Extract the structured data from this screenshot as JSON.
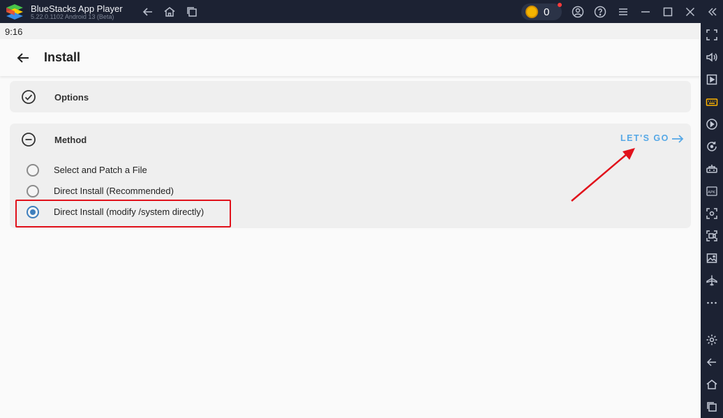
{
  "window": {
    "title": "BlueStacks App Player",
    "version": "5.22.0.1102  Android 13 (Beta)",
    "coins": "0",
    "titlebar_icons": [
      "back-icon",
      "home-icon",
      "multi-instance-icon",
      "account-icon",
      "help-icon",
      "menu-icon",
      "minimize-icon",
      "maximize-icon",
      "close-icon"
    ]
  },
  "android": {
    "clock": "9:16",
    "page_title": "Install",
    "options_card": {
      "title": "Options"
    },
    "method_card": {
      "title": "Method",
      "action_label": "LET'S GO",
      "options": [
        {
          "label": "Select and Patch a File",
          "selected": false
        },
        {
          "label": "Direct Install (Recommended)",
          "selected": false
        },
        {
          "label": "Direct Install (modify /system directly)",
          "selected": true
        }
      ]
    }
  },
  "sidebar_icons": [
    "fullscreen-icon",
    "volume-icon",
    "media-icon",
    "keyboard-controls-icon",
    "macro-icon",
    "rotate-icon",
    "gamepad-icon",
    "install-apk-icon",
    "screenshot-icon",
    "record-icon",
    "gallery-icon",
    "airplane-mode-icon",
    "more-icon",
    "settings-icon",
    "android-back-icon",
    "android-home-icon",
    "android-recents-icon"
  ],
  "colors": {
    "accent": "#56a8e6",
    "radio_selected": "#3f7fbd",
    "annotation": "#e1111b",
    "sidebar_active": "#ffb400"
  }
}
